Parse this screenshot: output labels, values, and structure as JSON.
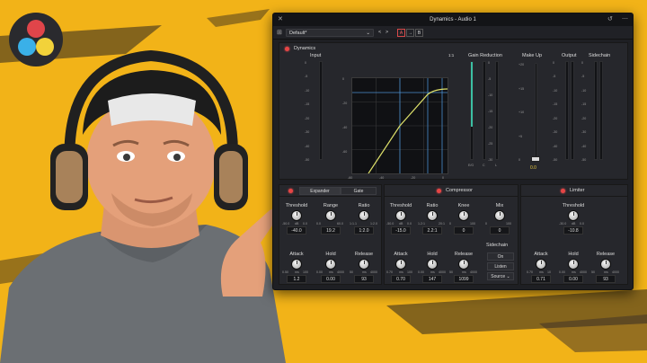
{
  "window": {
    "title": "Dynamics - Audio 1"
  },
  "toolbar": {
    "preset": "Default*",
    "prev": "<",
    "next": ">",
    "a_label": "A",
    "arrow": "→",
    "b_label": "B"
  },
  "dynamics": {
    "title": "Dynamics",
    "input_label": "Input",
    "gain_label": "Gain Reduction",
    "makeup_label": "Make Up",
    "output_label": "Output",
    "sidechain_label": "Sidechain",
    "ratio_1to1": "1:1",
    "meter_scale": [
      "0",
      "-5",
      "-10",
      "-15",
      "-20",
      "-30",
      "-40",
      "-50"
    ],
    "input_scale": [
      "0",
      "-5",
      "-10",
      "-15",
      "-20",
      "-30",
      "-40",
      "-50"
    ],
    "gr_scale": [
      "0",
      "-5",
      "-10",
      "-15",
      "-20",
      "-25",
      "-30"
    ],
    "makeup_scale": [
      "+20",
      "+15",
      "+10",
      "+5",
      "0"
    ],
    "graph_y": [
      "0",
      "-20",
      "-40",
      "-60"
    ],
    "graph_x": [
      "-60",
      "-40",
      "-20",
      "0"
    ],
    "gr_labels": [
      "E/G",
      "C",
      "L"
    ],
    "makeup_value": "0.0"
  },
  "expander": {
    "tab1": "Expander",
    "tab2": "Gate",
    "threshold": {
      "label": "Threshold",
      "value": "-40.0",
      "min": "-50.0",
      "unit": "dB",
      "max": "0.0"
    },
    "range": {
      "label": "Range",
      "value": "19.2",
      "min": "0.0",
      "max": "60.0"
    },
    "ratio": {
      "label": "Ratio",
      "value": "1:2.0",
      "min": "1:1.1",
      "max": "1:2.0"
    },
    "attack": {
      "label": "Attack",
      "value": "1.2",
      "min": "0.50",
      "unit": "ms",
      "max": "100"
    },
    "hold": {
      "label": "Hold",
      "value": "0.00",
      "min": "0.00",
      "unit": "ms",
      "max": "4000"
    },
    "release": {
      "label": "Release",
      "value": "93",
      "min": "50",
      "unit": "ms",
      "max": "4000"
    }
  },
  "compressor": {
    "title": "Compressor",
    "threshold": {
      "label": "Threshold",
      "value": "-15.0",
      "min": "-50.0",
      "unit": "dB",
      "max": "0.0"
    },
    "ratio": {
      "label": "Ratio",
      "value": "2.2:1",
      "min": "1.2:1",
      "max": "20:1"
    },
    "knee": {
      "label": "Knee",
      "value": "0",
      "min": "0",
      "max": "100"
    },
    "mix": {
      "label": "Mix",
      "value": "0",
      "min": "0",
      "max": "100"
    },
    "attack": {
      "label": "Attack",
      "value": "0.70",
      "min": "0.70",
      "unit": "ms",
      "max": "100"
    },
    "hold": {
      "label": "Hold",
      "value": "147",
      "min": "0.00",
      "unit": "ms",
      "max": "4000"
    },
    "release": {
      "label": "Release",
      "value": "1099",
      "min": "50",
      "unit": "ms",
      "max": "4000"
    },
    "sidechain": {
      "label": "Sidechain",
      "on": "On",
      "listen": "Listen",
      "source": "Source"
    }
  },
  "limiter": {
    "title": "Limiter",
    "threshold": {
      "label": "Threshold",
      "value": "-10.8",
      "min": "-30.0",
      "unit": "dB",
      "max": "0.0"
    },
    "attack": {
      "label": "Attack",
      "value": "0.71",
      "min": "0.70",
      "unit": "ms",
      "max": "10"
    },
    "hold": {
      "label": "Hold",
      "value": "0.00",
      "min": "0.00",
      "unit": "ms",
      "max": "4000"
    },
    "release": {
      "label": "Release",
      "value": "93",
      "min": "50",
      "unit": "ms",
      "max": "4000"
    }
  },
  "colors": {
    "accent": "#e8c840",
    "meter": "#3bbfa3",
    "power": "#e64545",
    "background": "#f2b318"
  }
}
